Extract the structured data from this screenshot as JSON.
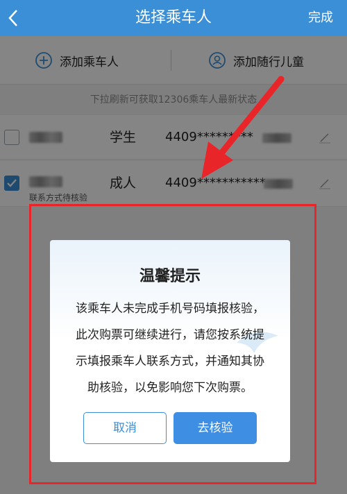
{
  "header": {
    "title": "选择乘车人",
    "done_label": "完成",
    "back_icon": "chevron-left-icon"
  },
  "addbar": {
    "add_passenger_label": "添加乘车人",
    "add_child_label": "添加随行儿童"
  },
  "tip": "下拉刷新可获取12306乘车人最新状态",
  "passengers": [
    {
      "type": "学生",
      "id_prefix": "4409",
      "id_mask": "*********",
      "checked": false
    },
    {
      "type": "成人",
      "id_prefix": "4409",
      "id_mask": "***********",
      "checked": true,
      "note": "联系方式待核验"
    }
  ],
  "dialog": {
    "title": "温馨提示",
    "body_lines": [
      "该乘车人未完成手机号码填报核验，",
      "此次购票可继续进行，请您按系统提",
      "示填报乘车人联系方式，并通知其协",
      "助核验，以免影响您下次购票。"
    ],
    "cancel_label": "取消",
    "confirm_label": "去核验"
  },
  "colors": {
    "brand": "#3a8fd6",
    "annotation_red": "#e8262a",
    "overlay": "rgba(0,0,0,0.48)"
  }
}
